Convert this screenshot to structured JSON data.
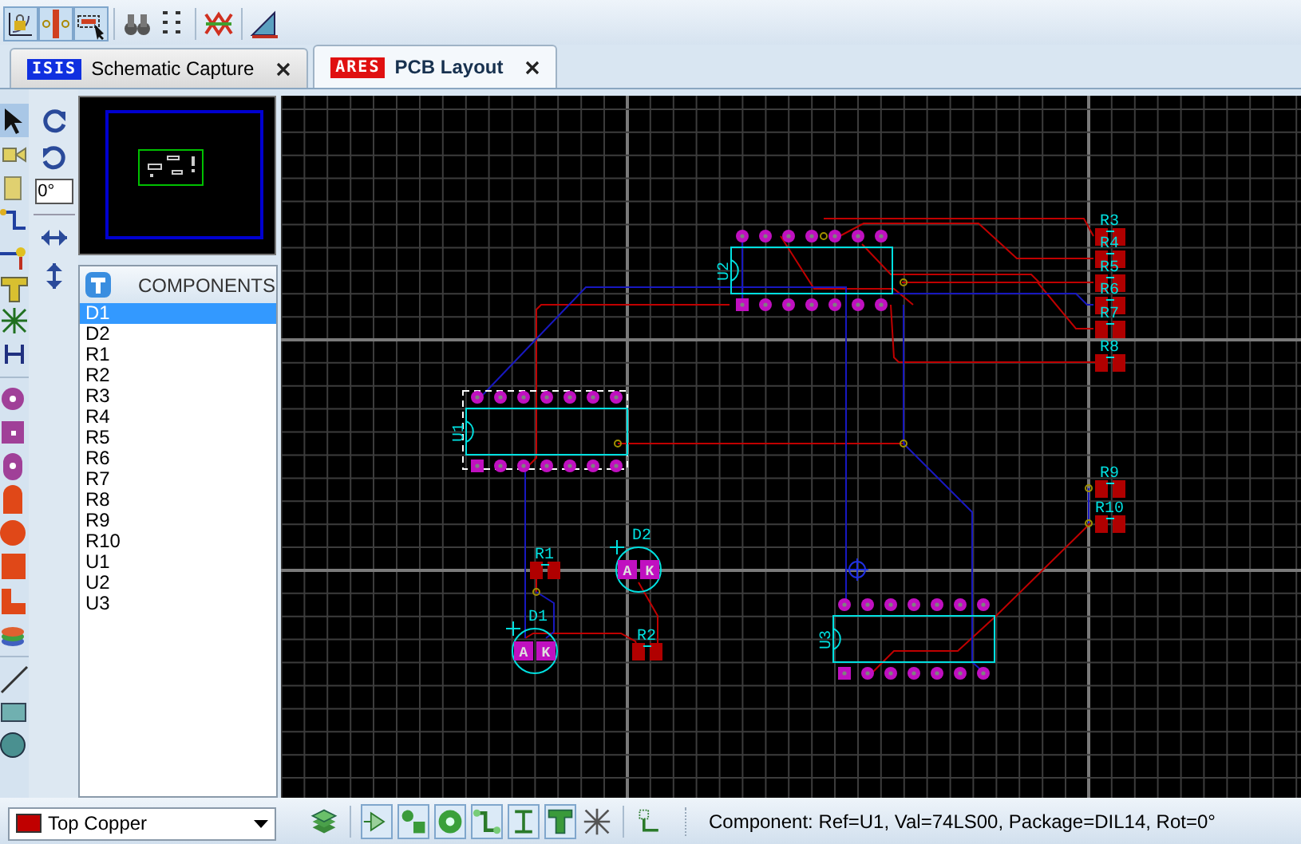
{
  "toolbar": [
    {
      "kind": "lock-grid",
      "pressed": true
    },
    {
      "kind": "pins",
      "pressed": true
    },
    {
      "kind": "select-box",
      "pressed": true
    },
    {
      "kind": "binoculars",
      "pressed": false
    },
    {
      "kind": "annotate",
      "pressed": false
    },
    {
      "kind": "netlist",
      "pressed": false
    },
    {
      "kind": "design-check",
      "pressed": false
    }
  ],
  "tabs": [
    {
      "label": "Schematic Capture",
      "selected": false,
      "logo": {
        "text": "ISIS",
        "color": "#1030e0"
      }
    },
    {
      "label": "PCB Layout",
      "selected": true,
      "logo": {
        "text": "ARES",
        "color": "#e01010"
      }
    }
  ],
  "left_tools": [
    {
      "kind": "select",
      "selected": true
    },
    {
      "kind": "component",
      "selected": false
    },
    {
      "kind": "package",
      "selected": false
    },
    {
      "kind": "track",
      "selected": false
    },
    {
      "kind": "via",
      "selected": false
    },
    {
      "kind": "terminal",
      "selected": false
    },
    {
      "kind": "ratsnest",
      "selected": false
    },
    {
      "kind": "connectivity",
      "selected": false
    },
    {
      "kind": "pad-round",
      "selected": false
    },
    {
      "kind": "pad-square",
      "selected": false
    },
    {
      "kind": "pad-dil",
      "selected": false
    },
    {
      "kind": "pad-edge",
      "selected": false
    },
    {
      "kind": "pad-circle",
      "selected": false
    },
    {
      "kind": "pad-rect",
      "selected": false
    },
    {
      "kind": "pad-polygon",
      "selected": false
    },
    {
      "kind": "padstack",
      "selected": false
    },
    {
      "kind": "line",
      "selected": false
    },
    {
      "kind": "box",
      "selected": false
    },
    {
      "kind": "circle",
      "selected": false
    }
  ],
  "rotation": {
    "value": "0°"
  },
  "components_panel": {
    "title": "COMPONENTS",
    "items": [
      {
        "label": "D1",
        "selected": true
      },
      {
        "label": "D2",
        "selected": false
      },
      {
        "label": "R1",
        "selected": false
      },
      {
        "label": "R2",
        "selected": false
      },
      {
        "label": "R3",
        "selected": false
      },
      {
        "label": "R4",
        "selected": false
      },
      {
        "label": "R5",
        "selected": false
      },
      {
        "label": "R6",
        "selected": false
      },
      {
        "label": "R7",
        "selected": false
      },
      {
        "label": "R8",
        "selected": false
      },
      {
        "label": "R9",
        "selected": false
      },
      {
        "label": "R10",
        "selected": false
      },
      {
        "label": "U1",
        "selected": false
      },
      {
        "label": "U2",
        "selected": false
      },
      {
        "label": "U3",
        "selected": false
      }
    ]
  },
  "layer_selector": {
    "value": "Top Copper"
  },
  "board": {
    "components": [
      {
        "kind": "dip14",
        "ref": "U2",
        "selected": false
      },
      {
        "kind": "resistor",
        "ref": "R3",
        "selected": false
      },
      {
        "kind": "resistor",
        "ref": "R4",
        "selected": false
      },
      {
        "kind": "resistor",
        "ref": "R5",
        "selected": false
      },
      {
        "kind": "resistor",
        "ref": "R6",
        "selected": false
      },
      {
        "kind": "resistor",
        "ref": "R7",
        "selected": false
      },
      {
        "kind": "resistor",
        "ref": "R8",
        "selected": false
      },
      {
        "kind": "dip14",
        "ref": "U1",
        "selected": true
      },
      {
        "kind": "resistor",
        "ref": "R9",
        "selected": false
      },
      {
        "kind": "resistor",
        "ref": "R10",
        "selected": false
      },
      {
        "kind": "resistor",
        "ref": "R1",
        "selected": false
      },
      {
        "kind": "diode",
        "ref": "D2",
        "pads": [
          "A",
          "K"
        ],
        "selected": false
      },
      {
        "kind": "diode",
        "ref": "D1",
        "pads": [
          "A",
          "K"
        ],
        "selected": false
      },
      {
        "kind": "resistor",
        "ref": "R2",
        "selected": false
      },
      {
        "kind": "dip14",
        "ref": "U3",
        "selected": false
      }
    ]
  },
  "bottom_tools": [
    {
      "kind": "layers",
      "pressed": false
    },
    {
      "kind": "component",
      "pressed": true
    },
    {
      "kind": "pad-pair",
      "pressed": true
    },
    {
      "kind": "pad-round",
      "pressed": true
    },
    {
      "kind": "track",
      "pressed": true
    },
    {
      "kind": "connector",
      "pressed": true
    },
    {
      "kind": "terminal",
      "pressed": true
    },
    {
      "kind": "ratsnest",
      "pressed": false
    },
    {
      "kind": "autoplace",
      "pressed": false
    }
  ],
  "status_bar": {
    "text": "Component:  Ref=U1, Val=74LS00, Package=DIL14, Rot=0°"
  }
}
